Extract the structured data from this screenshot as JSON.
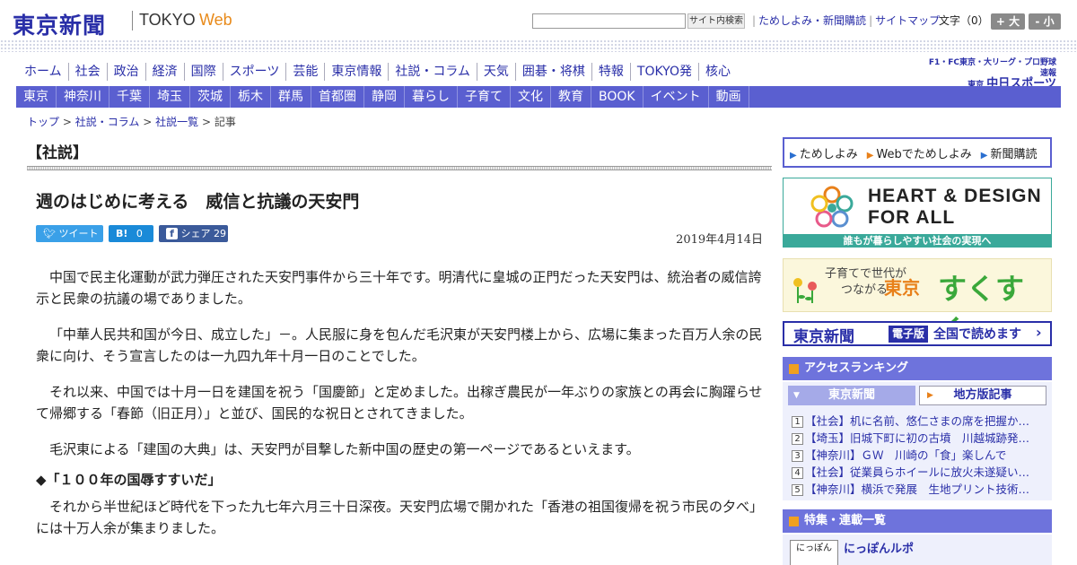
{
  "header": {
    "logo": "東京新聞",
    "logo_tokyo": "TOKYO",
    "logo_web": "Web",
    "search_placeholder": "",
    "search_button": "サイト内検索",
    "links": [
      "ためしよみ・新聞購読",
      "サイトマップ"
    ],
    "font_size_label": "文字（0）",
    "font_larger": "+ 大",
    "font_smaller": "- 小"
  },
  "nav_main": [
    "ホーム",
    "社会",
    "政治",
    "経済",
    "国際",
    "スポーツ",
    "芸能",
    "東京情報",
    "社説・コラム",
    "天気",
    "囲碁・将棋",
    "特報",
    "TOKYO発",
    "核心"
  ],
  "chunichi": {
    "line1": "F1・FC東京・大リーグ・プロ野球速報",
    "line2_prefix": "東京",
    "line2_name": "中日スポーツ"
  },
  "nav_region": [
    "東京",
    "神奈川",
    "千葉",
    "埼玉",
    "茨城",
    "栃木",
    "群馬",
    "首都圏",
    "静岡",
    "暮らし",
    "子育て",
    "文化",
    "教育",
    "BOOK",
    "イベント",
    "動画"
  ],
  "breadcrumb": {
    "items": [
      "トップ",
      "社説・コラム",
      "社説一覧"
    ],
    "current": "記事",
    "sep": ">"
  },
  "article": {
    "section": "【社説】",
    "title": "週のはじめに考える　威信と抗議の天安門",
    "date": "2019年4月14日",
    "share": {
      "tweet": "ツイート",
      "hatena_label": "B!",
      "hatena_count": "0",
      "fb_label": "シェア",
      "fb_count": "29"
    },
    "paragraphs": [
      "中国で民主化運動が武力弾圧された天安門事件から三十年です。明清代に皇城の正門だった天安門は、統治者の威信誇示と民衆の抗議の場でありました。",
      "「中華人民共和国が今日、成立した」－。人民服に身を包んだ毛沢東が天安門楼上から、広場に集まった百万人余の民衆に向け、そう宣言したのは一九四九年十月一日のことでした。",
      "それ以来、中国では十月一日を建国を祝う「国慶節」と定めました。出稼ぎ農民が一年ぶりの家族との再会に胸躍らせて帰郷する「春節（旧正月）」と並び、国民的な祝日とされてきました。",
      "毛沢東による「建国の大典」は、天安門が目撃した新中国の歴史の第一ページであるといえます。"
    ],
    "subhead": "◆「１００年の国辱すすいだ」",
    "paragraphs2": [
      "それから半世紀ほど時代を下った九七年六月三十日深夜。天安門広場で開かれた「香港の祖国復帰を祝う市民の夕べ」には十万人余が集まりました。"
    ]
  },
  "sidebar": {
    "tameshi": [
      "ためしよみ",
      "Webでためしよみ",
      "新聞購読"
    ],
    "heart": {
      "title_line1": "HEART & DESIGN",
      "title_line2": "FOR ALL",
      "caption": "誰もが暮らしやすい社会の実現へ"
    },
    "sukusuku": {
      "small_line1": "子育てで世代が",
      "small_line2": "つながる",
      "tokyo": "東京",
      "big": "すくすく"
    },
    "denshi": {
      "logo": "東京新聞",
      "tag": "電子版",
      "text": "全国で読めます"
    },
    "ranking": {
      "title": "アクセスランキング",
      "tab_tokyo": "東京新聞",
      "tab_local": "地方版記事",
      "items": [
        {
          "n": "1",
          "text": "【社会】机に名前、悠仁さまの席を把握か…"
        },
        {
          "n": "2",
          "text": "【埼玉】旧城下町に初の古墳　川越城跡発…"
        },
        {
          "n": "3",
          "text": "【神奈川】ＧＷ　川崎の「食」楽しんで"
        },
        {
          "n": "4",
          "text": "【社会】従業員らホイールに放火未遂疑い…"
        },
        {
          "n": "5",
          "text": "【神奈川】横浜で発展　生地プリント技術…"
        }
      ]
    },
    "features": {
      "title": "特集・連載一覧",
      "item_title": "にっぽんルポ",
      "item_img_text": "にっぽん"
    }
  }
}
